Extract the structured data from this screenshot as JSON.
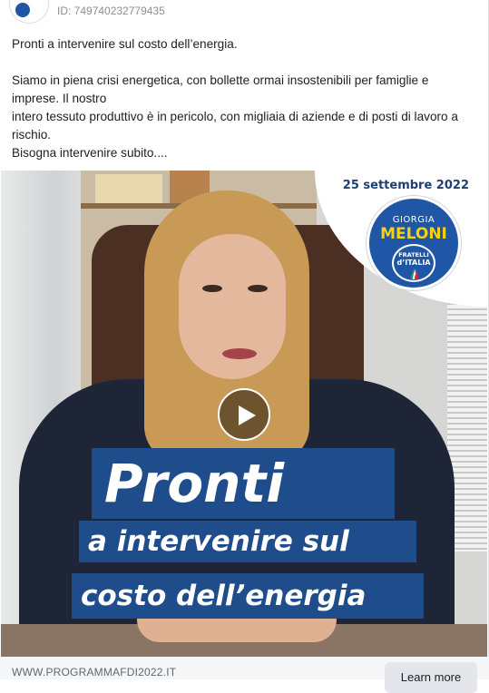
{
  "post": {
    "ad_id": "ID: 749740232779435",
    "text_lines": {
      "line1": "Pronti a intervenire sul costo dell’energia.",
      "line2": "Siamo in piena crisi energetica, con bollette ormai insostenibili per famiglie e",
      "line3": "imprese. Il nostro",
      "line4": "intero tessuto produttivo è in pericolo, con migliaia di aziende e di posti di lavoro a",
      "line5": "rischio.",
      "line6": "Bisogna intervenire subito...."
    }
  },
  "media": {
    "date": "25 settembre 2022",
    "logo": {
      "first_name": "GIORGIA",
      "last_name": "MELONI",
      "party_line1": "FRATELLI",
      "party_line2": "d’ITALIA"
    },
    "headline": {
      "line1": "Pronti",
      "line2": "a intervenire sul",
      "line3": "costo dell’energia"
    },
    "play_icon": "play-icon"
  },
  "footer": {
    "link_text": "WWW.PROGRAMMAFDI2022.IT",
    "cta_label": "Learn more"
  },
  "colors": {
    "brand_blue": "#1f4d8c",
    "logo_yellow": "#f6d10f"
  }
}
